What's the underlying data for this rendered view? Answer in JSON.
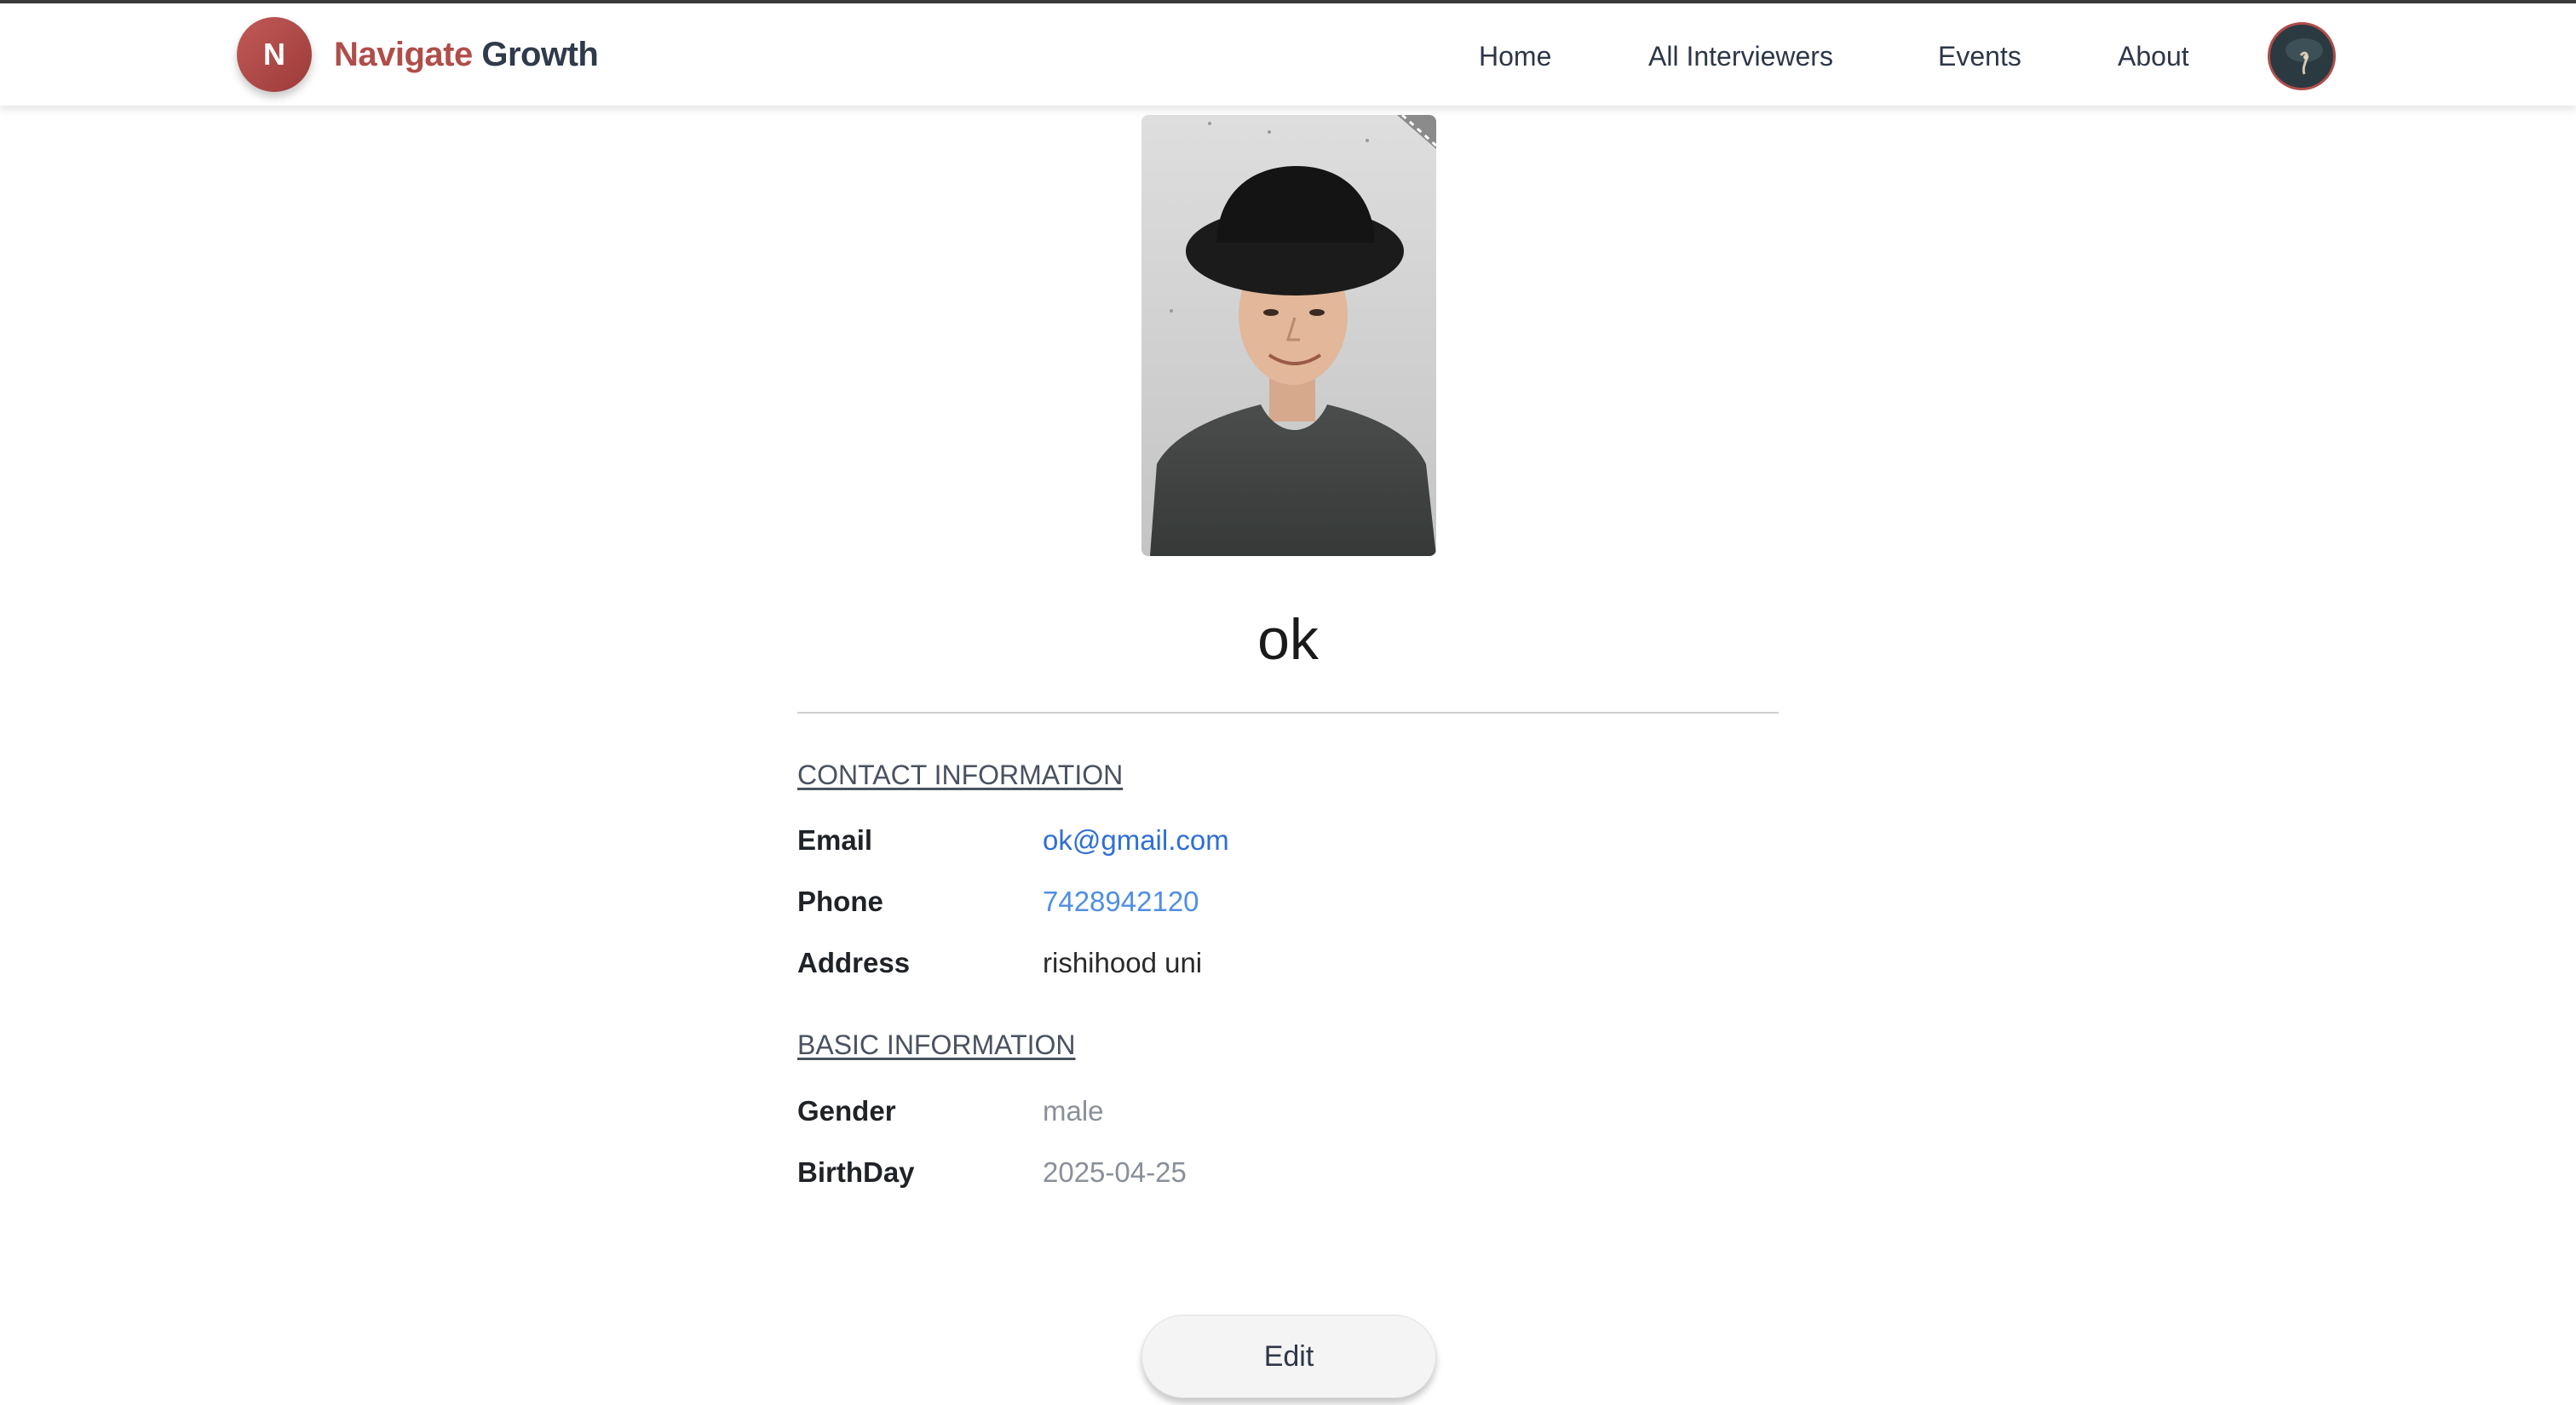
{
  "header": {
    "logo_letter": "N",
    "brand_part1": "Navigate",
    "brand_part2": "Growth",
    "nav": [
      "Home",
      "All Interviewers",
      "Events",
      "About"
    ]
  },
  "profile": {
    "name": "ok"
  },
  "contact": {
    "title": "CONTACT INFORMATION",
    "email_label": "Email",
    "email": "ok@gmail.com",
    "phone_label": "Phone",
    "phone": "7428942120",
    "address_label": "Address",
    "address": "rishihood uni"
  },
  "basic": {
    "title": "BASIC INFORMATION",
    "gender_label": "Gender",
    "gender": "male",
    "birthday_label": "BirthDay",
    "birthday": "2025-04-25"
  },
  "actions": {
    "edit_label": "Edit"
  },
  "colors": {
    "brand_red": "#b04d4a",
    "brand_dark": "#2f3a4a",
    "link_blue": "#2f6fd6",
    "muted_gray": "#8a9099"
  }
}
